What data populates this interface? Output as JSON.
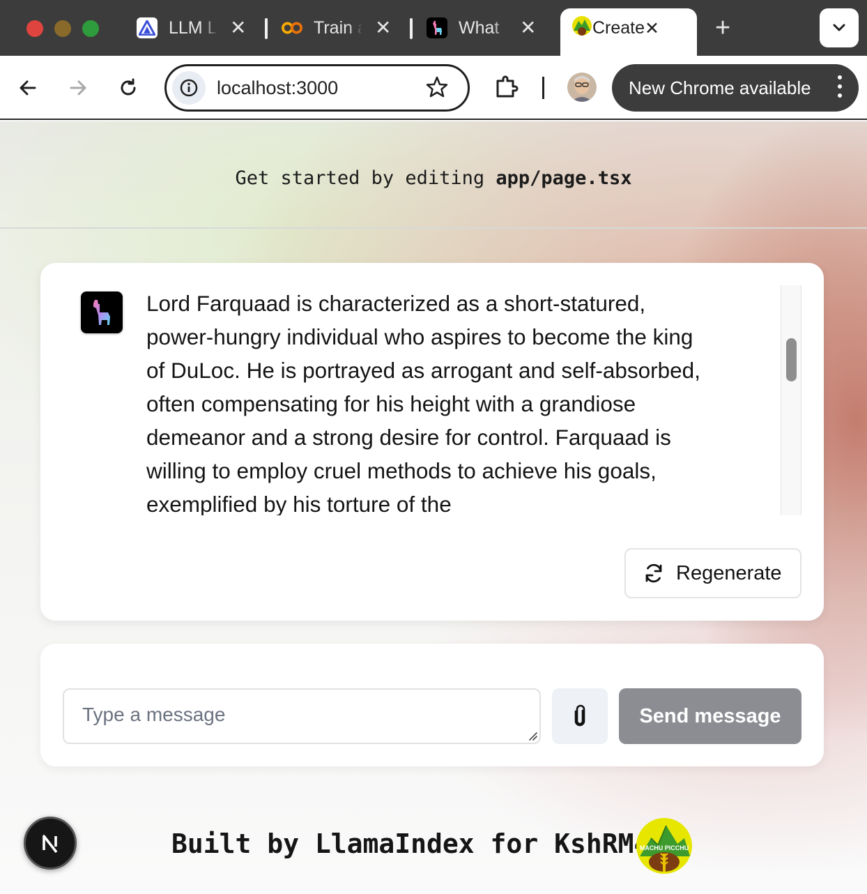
{
  "browser": {
    "tabs": [
      {
        "title": "LLM L",
        "close": "✕",
        "icon": "llm-triangle-icon"
      },
      {
        "title": "Train a",
        "close": "✕",
        "icon": "colab-icon"
      },
      {
        "title": "What",
        "close": "✕",
        "icon": "llama-icon"
      },
      {
        "title": "Create",
        "close": "✕",
        "icon": "machu-picchu-icon",
        "active": true
      }
    ],
    "new_tab": "+",
    "url": "localhost:3000",
    "update_label": "New Chrome available"
  },
  "page": {
    "get_started_prefix": "Get started by editing ",
    "get_started_file": "app/page.tsx",
    "chat": {
      "message": "Lord Farquaad is characterized as a short-statured, power-hungry individual who aspires to become the king of DuLoc. He is portrayed as arrogant and self-absorbed, often compensating for his height with a grandiose demeanor and a strong desire for control. Farquaad is willing to employ cruel methods to achieve his goals, exemplified by his torture of the",
      "regenerate_label": "Regenerate"
    },
    "input": {
      "placeholder": "Type a message",
      "value": "",
      "send_label": "Send message"
    },
    "next_badge": "N",
    "footer": "Built by LlamaIndex for KshRM4",
    "logo_text": "MACHU PICCHU"
  },
  "colors": {
    "tabstrip_bg": "#3c3c3c",
    "send_button": "#8b8d93",
    "attach_button": "#eef1f6"
  }
}
